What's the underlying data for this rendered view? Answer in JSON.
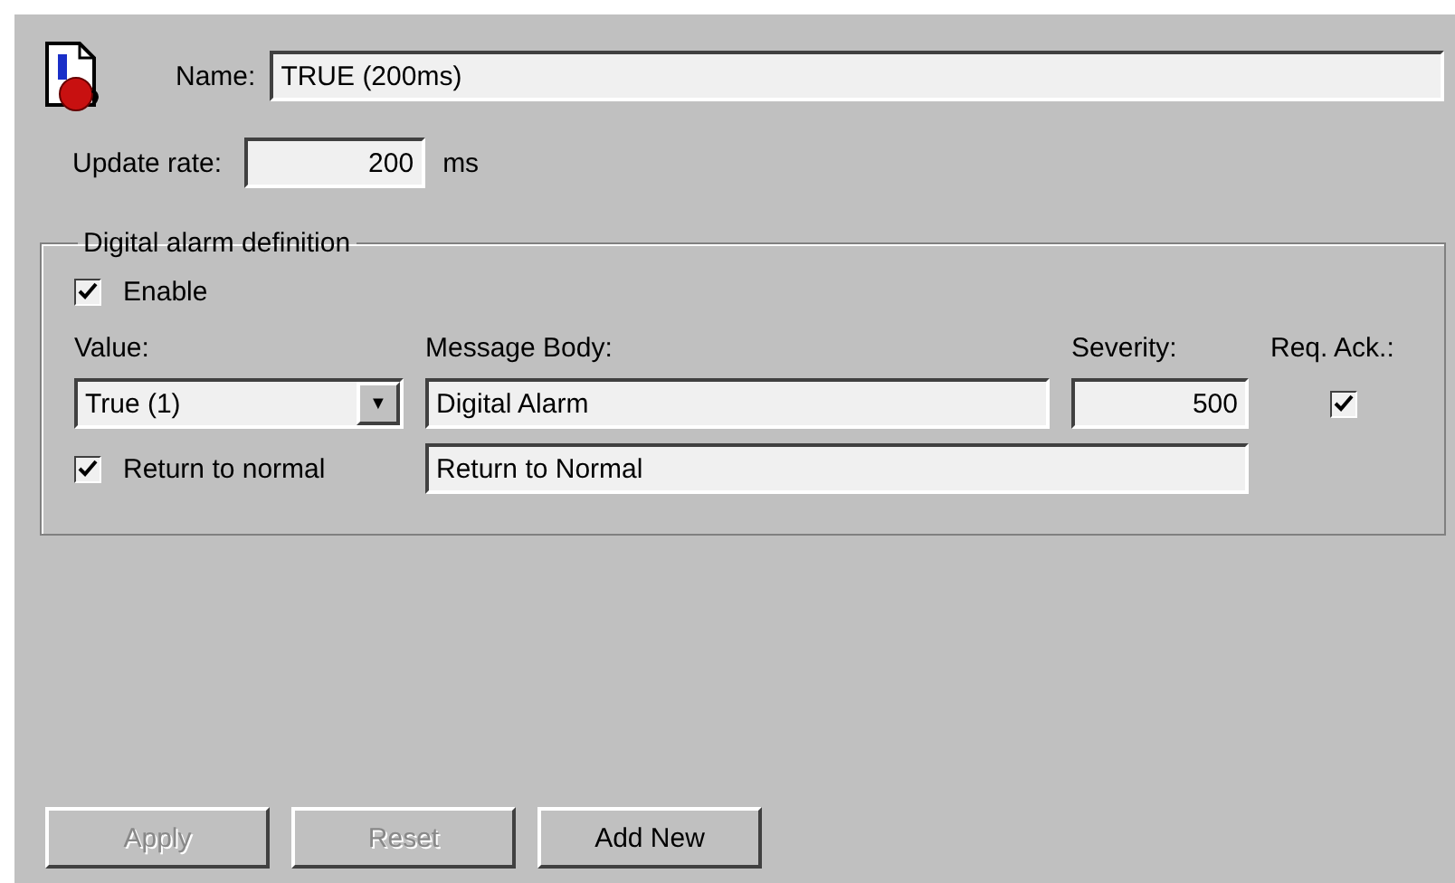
{
  "name_field": {
    "label": "Name:",
    "value": "TRUE (200ms)"
  },
  "update_rate": {
    "label": "Update rate:",
    "value": "200",
    "unit": "ms"
  },
  "group": {
    "title": "Digital alarm definition",
    "enable": {
      "label": "Enable",
      "checked": true
    },
    "columns": [
      "Value:",
      "Message Body:",
      "Severity:",
      "Req. Ack.:"
    ],
    "value_dropdown": {
      "value": "True (1)",
      "arrow": "▼"
    },
    "message_body": "Digital Alarm",
    "severity": "500",
    "req_ack": {
      "checked": true
    },
    "return_to_normal": {
      "label": "Return to normal",
      "checked": true,
      "message": "Return to Normal"
    }
  },
  "buttons": [
    {
      "label": "Apply",
      "disabled": true
    },
    {
      "label": "Reset",
      "disabled": true
    },
    {
      "label": "Add New",
      "disabled": false
    }
  ]
}
